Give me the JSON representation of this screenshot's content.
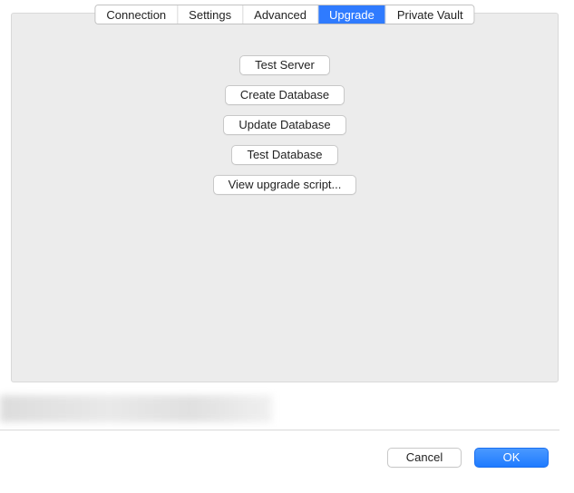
{
  "tabs": {
    "connection": "Connection",
    "settings": "Settings",
    "advanced": "Advanced",
    "upgrade": "Upgrade",
    "private_vault": "Private Vault",
    "active": "upgrade"
  },
  "actions": {
    "test_server": "Test Server",
    "create_database": "Create Database",
    "update_database": "Update Database",
    "test_database": "Test Database",
    "view_upgrade_script": "View upgrade script..."
  },
  "footer": {
    "cancel": "Cancel",
    "ok": "OK"
  },
  "colors": {
    "accent": "#2f7bff",
    "pane_bg": "#ececec"
  }
}
